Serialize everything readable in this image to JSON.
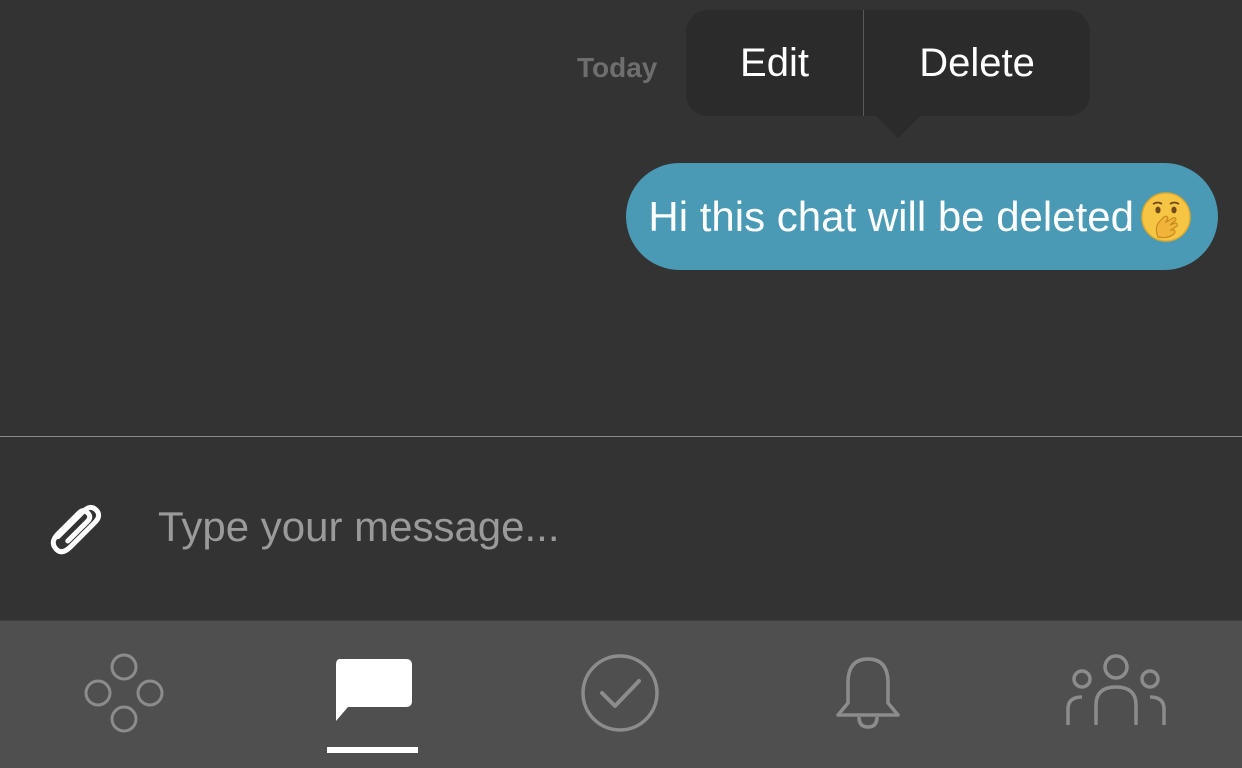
{
  "chat": {
    "date_label": "Today",
    "messages": [
      {
        "text": "Hi this chat will be deleted",
        "emoji": "face-with-hand-over-mouth",
        "sender": "self"
      }
    ]
  },
  "context_menu": {
    "edit_label": "Edit",
    "delete_label": "Delete"
  },
  "composer": {
    "placeholder": "Type your message...",
    "value": "",
    "attach_icon": "paperclip-icon"
  },
  "tab_bar": {
    "active_tab": 1,
    "tabs": [
      {
        "icon": "four-circles-icon"
      },
      {
        "icon": "chat-bubble-icon"
      },
      {
        "icon": "check-circle-icon"
      },
      {
        "icon": "bell-icon"
      },
      {
        "icon": "people-group-icon"
      }
    ]
  },
  "colors": {
    "background": "#333333",
    "bubble": "#4a9ab5",
    "tab_bar": "#4f4f4f",
    "menu": "#2b2b2b",
    "inactive_icon": "#8c8c8c",
    "active_icon": "#ffffff"
  }
}
